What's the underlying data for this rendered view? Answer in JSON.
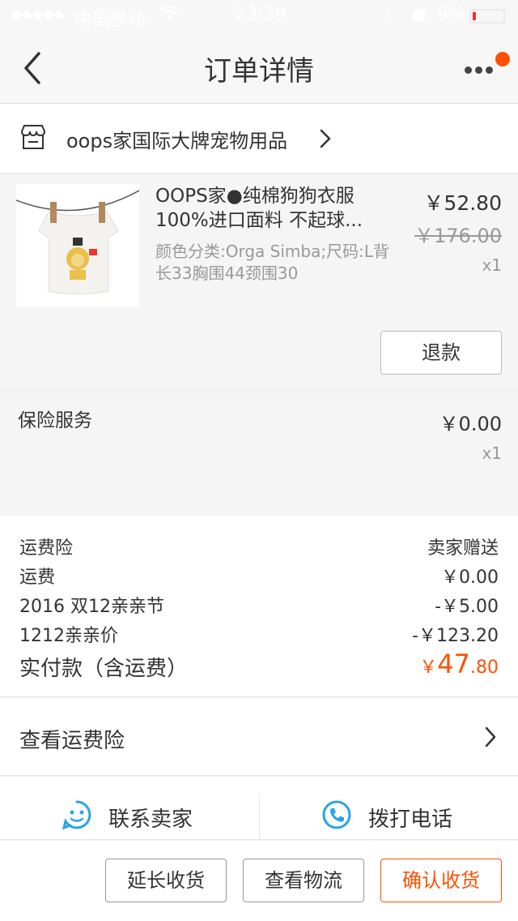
{
  "status_bar": {
    "carrier": "中国移动",
    "time": "23:29",
    "battery": "9%"
  },
  "nav": {
    "title": "订单详情",
    "back_icon": "chevron-left-icon",
    "more_icon": "more-dots-icon"
  },
  "shop": {
    "name": "oops家国际大牌宠物用品",
    "icon": "store-icon"
  },
  "product": {
    "title": "OOPS家●纯棉狗狗衣服100%进口面料 不起球...",
    "sku": "颜色分类:Orga Simba;尺码:L背长33胸围44颈围30",
    "price": "￥52.80",
    "original_price": "￥176.00",
    "quantity": "x1",
    "refund_label": "退款"
  },
  "insurance": {
    "label": "保险服务",
    "price": "￥0.00",
    "quantity": "x1"
  },
  "summary": {
    "rows": [
      {
        "label": "运费险",
        "value": "卖家赠送"
      },
      {
        "label": "运费",
        "value": "￥0.00"
      },
      {
        "label": "2016 双12亲亲节",
        "value": "-￥5.00"
      },
      {
        "label": "1212亲亲价",
        "value": "-￥123.20"
      }
    ],
    "paid_label": "实付款（含运费）",
    "paid_currency": "￥",
    "paid_integer": "47",
    "paid_decimal": ".80"
  },
  "freight_insurance": {
    "label": "查看运费险"
  },
  "contact": {
    "seller_label": "联系卖家",
    "phone_label": "拨打电话"
  },
  "actions": {
    "extend_label": "延长收货",
    "logistics_label": "查看物流",
    "confirm_label": "确认收货"
  },
  "colors": {
    "accent": "#ff5000",
    "icon_blue": "#29a3e8"
  }
}
